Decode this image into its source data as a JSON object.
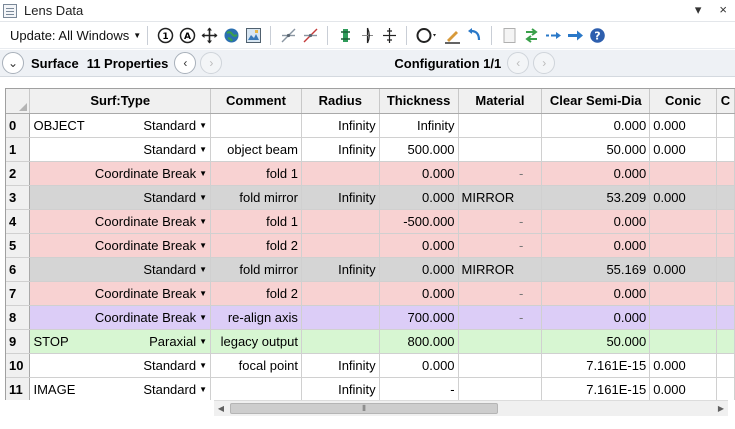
{
  "window": {
    "title": "Lens Data",
    "pin": "▾",
    "close": "×"
  },
  "toolbar": {
    "update_label": "Update: All Windows",
    "tools": [
      "settings-one-icon",
      "settings-a-icon",
      "move-icon",
      "globe-icon",
      "image-icon",
      "scale-icon",
      "scale-red-icon",
      "glass-icon",
      "lens-icon",
      "mirror-icon",
      "aperture-icon",
      "edit-icon",
      "undo-icon",
      "blank-icon",
      "swap-icon",
      "arrow-dash-icon",
      "arrow-right-icon",
      "help-icon"
    ]
  },
  "nav": {
    "surface_label": "Surface",
    "properties_label": "11 Properties",
    "configuration_label": "Configuration 1/1"
  },
  "columns": [
    "Surf:Type",
    "Comment",
    "Radius",
    "Thickness",
    "Material",
    "Clear Semi-Dia",
    "Conic",
    "C"
  ],
  "rows": [
    {
      "num": "0",
      "name": "OBJECT",
      "type": "Standard",
      "comment": "",
      "radius": "Infinity",
      "thickness": "Infinity",
      "material": "",
      "semidia": "0.000",
      "conic": "0.000",
      "style": ""
    },
    {
      "num": "1",
      "name": "",
      "type": "Standard",
      "comment": "object beam",
      "radius": "Infinity",
      "thickness": "500.000",
      "material": "",
      "semidia": "50.000",
      "conic": "0.000",
      "style": ""
    },
    {
      "num": "2",
      "name": "",
      "type": "Coordinate Break",
      "comment": "fold 1",
      "radius": "",
      "thickness": "0.000",
      "material": "-",
      "semidia": "0.000",
      "conic": "",
      "style": "cb"
    },
    {
      "num": "3",
      "name": "",
      "type": "Standard",
      "comment": "fold mirror",
      "radius": "Infinity",
      "thickness": "0.000",
      "material": "MIRROR",
      "semidia": "53.209",
      "conic": "0.000",
      "style": "mirror"
    },
    {
      "num": "4",
      "name": "",
      "type": "Coordinate Break",
      "comment": "fold 1",
      "radius": "",
      "thickness": "-500.000",
      "material": "-",
      "semidia": "0.000",
      "conic": "",
      "style": "cb"
    },
    {
      "num": "5",
      "name": "",
      "type": "Coordinate Break",
      "comment": "fold 2",
      "radius": "",
      "thickness": "0.000",
      "material": "-",
      "semidia": "0.000",
      "conic": "",
      "style": "cb"
    },
    {
      "num": "6",
      "name": "",
      "type": "Standard",
      "comment": "fold mirror",
      "radius": "Infinity",
      "thickness": "0.000",
      "material": "MIRROR",
      "semidia": "55.169",
      "conic": "0.000",
      "style": "mirror"
    },
    {
      "num": "7",
      "name": "",
      "type": "Coordinate Break",
      "comment": "fold 2",
      "radius": "",
      "thickness": "0.000",
      "material": "-",
      "semidia": "0.000",
      "conic": "",
      "style": "cb"
    },
    {
      "num": "8",
      "name": "",
      "type": "Coordinate Break",
      "comment": "re-align axis",
      "radius": "",
      "thickness": "700.000",
      "material": "-",
      "semidia": "0.000",
      "conic": "",
      "style": "realign"
    },
    {
      "num": "9",
      "name": "STOP",
      "type": "Paraxial",
      "comment": "legacy output",
      "radius": "",
      "thickness": "800.000",
      "material": "",
      "semidia": "50.000",
      "conic": "",
      "style": "stop"
    },
    {
      "num": "10",
      "name": "",
      "type": "Standard",
      "comment": "focal point",
      "radius": "Infinity",
      "thickness": "0.000",
      "material": "",
      "semidia": "7.161E-15",
      "conic": "0.000",
      "style": ""
    },
    {
      "num": "11",
      "name": "IMAGE",
      "type": "Standard",
      "comment": "",
      "radius": "Infinity",
      "thickness": "-",
      "material": "",
      "semidia": "7.161E-15",
      "conic": "0.000",
      "style": ""
    }
  ],
  "colors": {
    "coordinate_break": "#f8d2d2",
    "mirror": "#d5d5d5",
    "realign": "#dccdf7",
    "stop": "#d7f6d2"
  }
}
